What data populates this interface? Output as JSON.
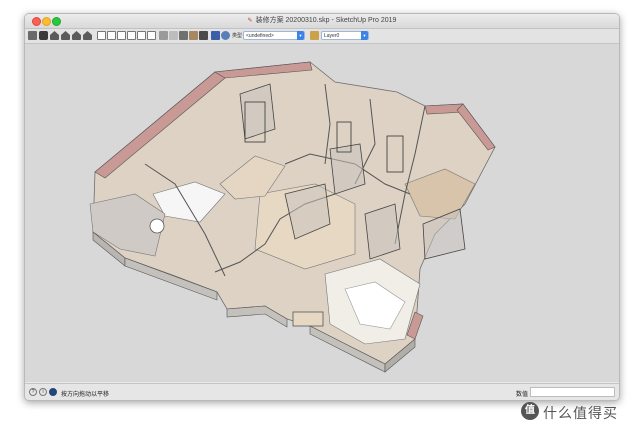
{
  "window": {
    "title": "装修方案 20200310.skp - SketchUp Pro 2019"
  },
  "toolbar": {
    "style_label": "类型",
    "style_value": "<undefined>",
    "layer_value": "Layer0",
    "icons": [
      "select-icon",
      "camera-icon",
      "house-icon",
      "house-icon",
      "house-icon",
      "house-icon",
      "iso-view-icon",
      "top-view-icon",
      "front-view-icon",
      "right-view-icon",
      "back-view-icon",
      "left-view-icon",
      "xray-icon",
      "wireframe-icon",
      "shaded-icon",
      "textured-icon",
      "monochrome-icon",
      "paint-bucket-icon",
      "push-pull-icon",
      "move-icon",
      "layer-icon"
    ]
  },
  "status": {
    "hint": "按方向拖动以平移",
    "measure_label": "数值",
    "measure_value": ""
  },
  "watermark": {
    "logo": "值",
    "text": "什么值得买"
  },
  "colors": {
    "wall_top": "#c99a95",
    "floor": "#e4d6c3",
    "glass": "#c9c3bd",
    "background": "#d8d8d8",
    "accent": "#3d83e6"
  }
}
